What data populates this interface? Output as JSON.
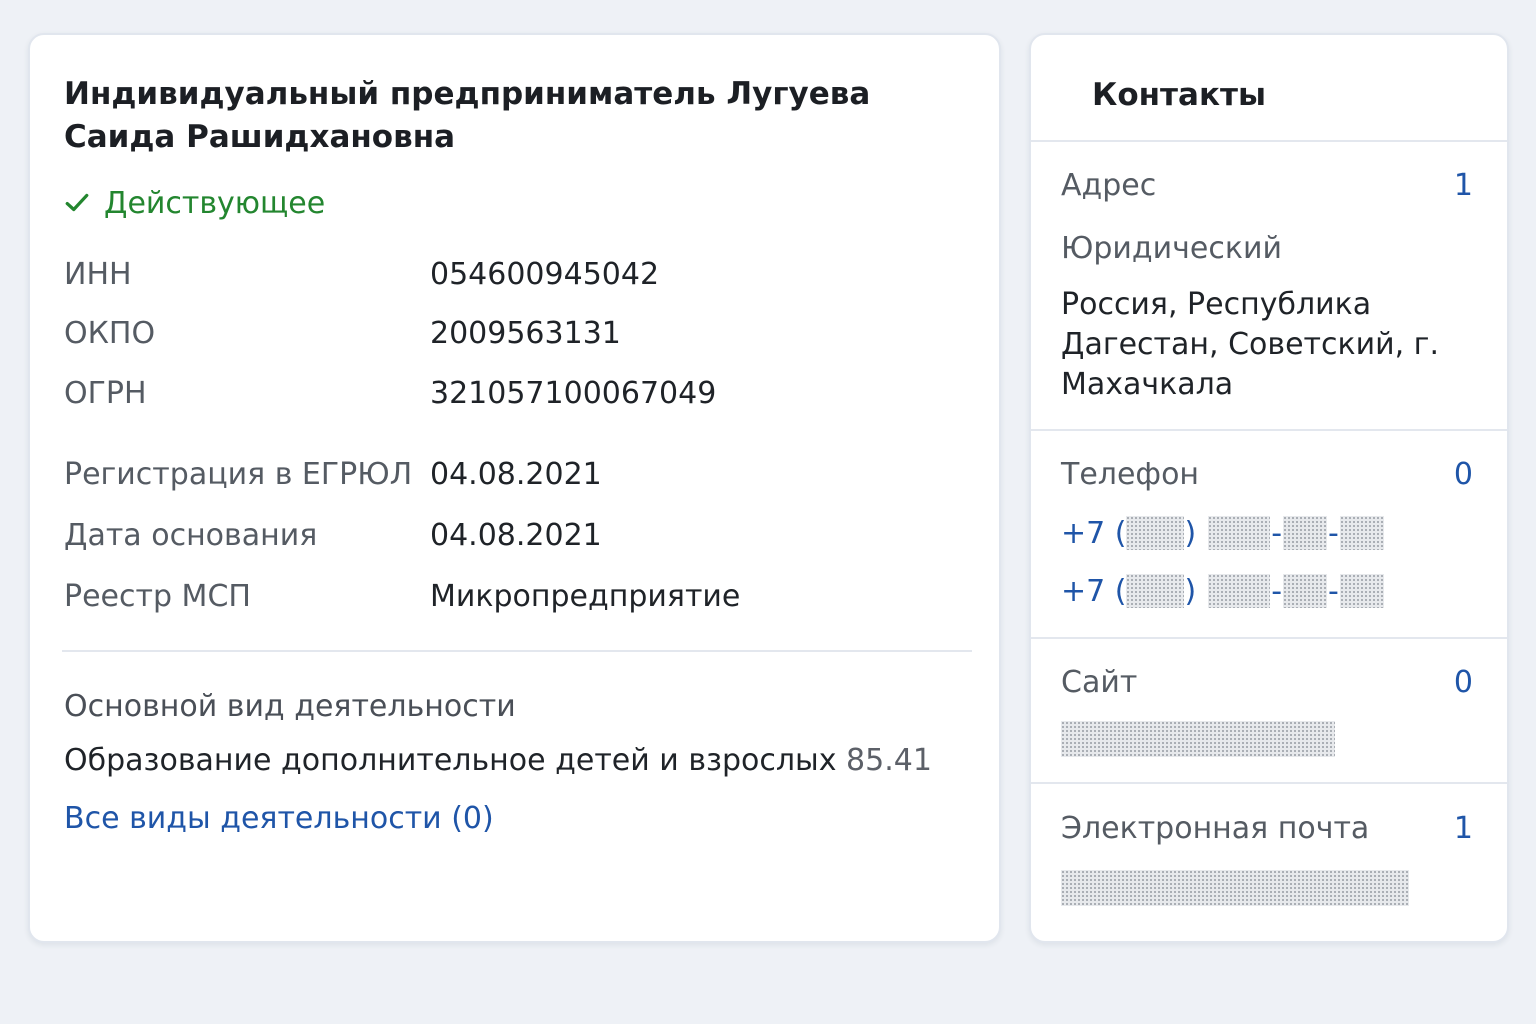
{
  "company": {
    "title": "Индивидуальный предприниматель Лугуева Саида Рашидхановна",
    "status": "Действующее",
    "status_color": "#23862f",
    "status_icon": "check-icon"
  },
  "requisites": [
    {
      "label": "ИНН",
      "value": "054600945042"
    },
    {
      "label": "ОКПО",
      "value": "2009563131"
    },
    {
      "label": "ОГРН",
      "value": "321057100067049"
    }
  ],
  "registration": [
    {
      "label": "Регистрация в ЕГРЮЛ",
      "value": "04.08.2021"
    },
    {
      "label": "Дата основания",
      "value": "04.08.2021"
    },
    {
      "label": "Реестр МСП",
      "value": "Микропредприятие"
    }
  ],
  "activity": {
    "title": "Основной вид деятельности",
    "name": "Образование дополнительное детей и взрослых",
    "code": "85.41",
    "all_link": "Все виды деятельности (0)"
  },
  "contacts": {
    "header": "Контакты",
    "address": {
      "label": "Адрес",
      "count": "1",
      "type": "Юридический",
      "text": "Россия, Республика Дагестан, Советский, г. Махачкала"
    },
    "phone": {
      "label": "Телефон",
      "count": "0",
      "prefix": "+7 (",
      "close": ")",
      "dash": "-",
      "items": 2
    },
    "site": {
      "label": "Сайт",
      "count": "0"
    },
    "email": {
      "label": "Электронная почта",
      "count": "1"
    }
  },
  "colors": {
    "link": "#1f55a8",
    "background": "#eef1f6"
  }
}
